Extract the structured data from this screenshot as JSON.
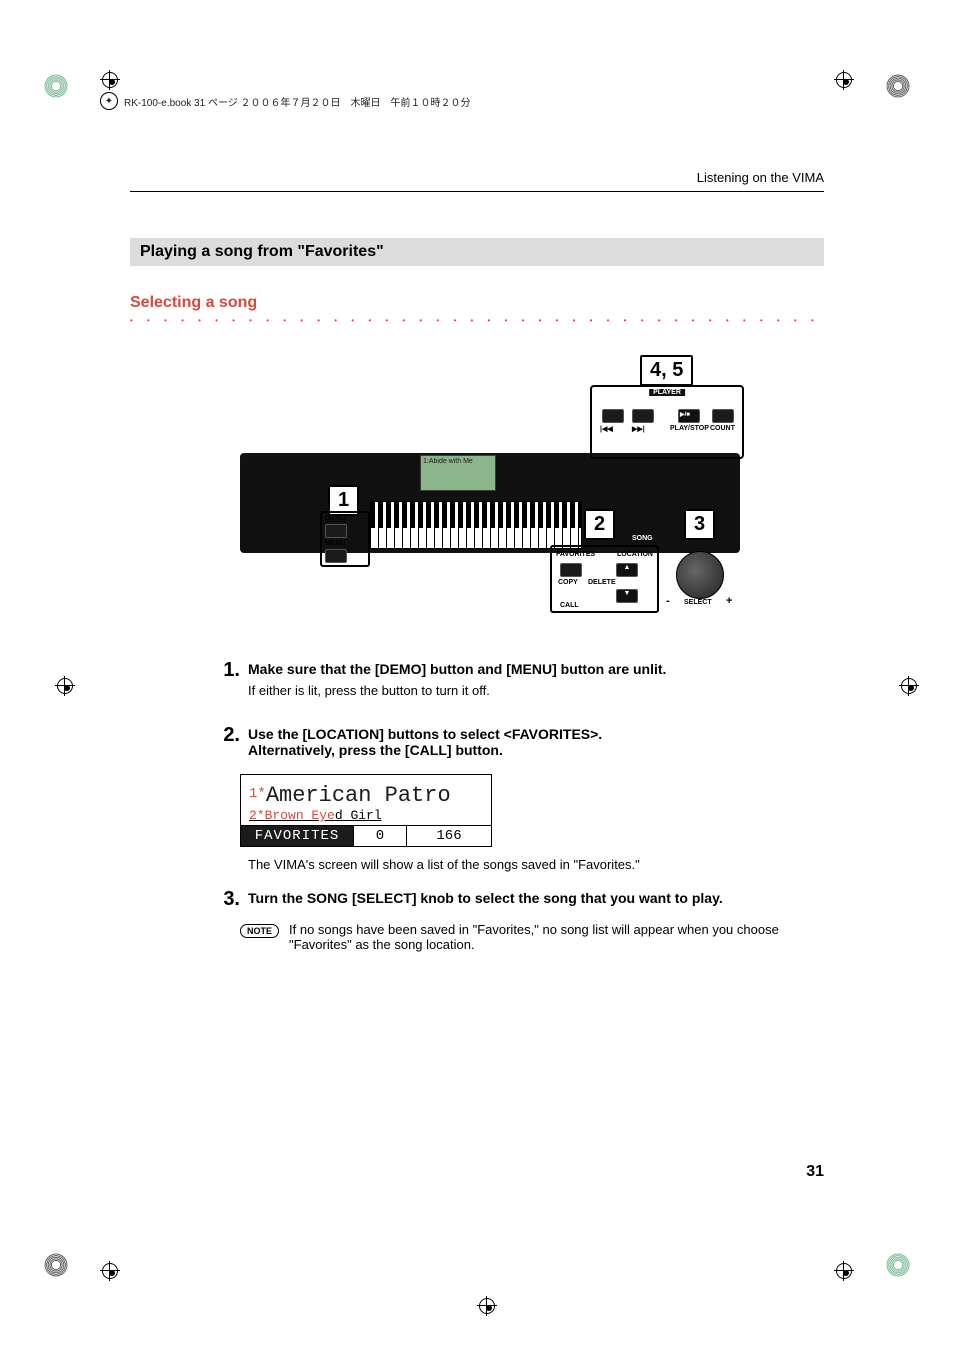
{
  "header_line": "RK-100-e.book  31 ページ  ２００６年７月２０日　木曜日　午前１０時２０分",
  "top_meta": "Listening on the VIMA",
  "section_title": "Playing a song from \"Favorites\"",
  "subsection_title": "Selecting a song",
  "diagram": {
    "callouts": {
      "c1": "1",
      "c2": "2",
      "c3": "3",
      "c45": "4, 5"
    },
    "labels": {
      "player": "PLAYER",
      "play_stop": "PLAY/STOP",
      "count": "COUNT",
      "demo": "DEMO",
      "menu": "MENU",
      "song": "SONG",
      "favorites": "FAVORITES",
      "location": "LOCATION",
      "copy": "COPY",
      "delete": "DELETE",
      "call": "CALL",
      "select": "SELECT",
      "minus": "-",
      "plus": "+",
      "lcd_song": "1:Abide with Me"
    }
  },
  "steps": [
    {
      "num": "1.",
      "head": "Make sure that the [DEMO] button and [MENU] button are unlit.",
      "text": "If either is lit, press the button to turn it off."
    },
    {
      "num": "2.",
      "head": "Use the [LOCATION] buttons to select <FAVORITES>.\nAlternatively, press the [CALL] button."
    },
    {
      "num": "3.",
      "head": "Turn the SONG [SELECT] knob to select the song that you want to play."
    }
  ],
  "lcdshot": {
    "sel_num": "1",
    "sel_asterisk": "*",
    "line1": "American Patro",
    "line2_prefix": "2",
    "line2_asterisk": "*",
    "line2_red": "Brown Eye",
    "line2_rest": "d Girl",
    "favorites_label": "FAVORITES",
    "measure": "0",
    "tempo": "166"
  },
  "after_lcd_text": "The VIMA's screen will show a list of the songs saved in \"Favorites.\"",
  "note_label": "NOTE",
  "note_text": "If no songs have been saved in \"Favorites,\" no song list will appear when you choose \"Favorites\" as the song location.",
  "page_number": "31"
}
